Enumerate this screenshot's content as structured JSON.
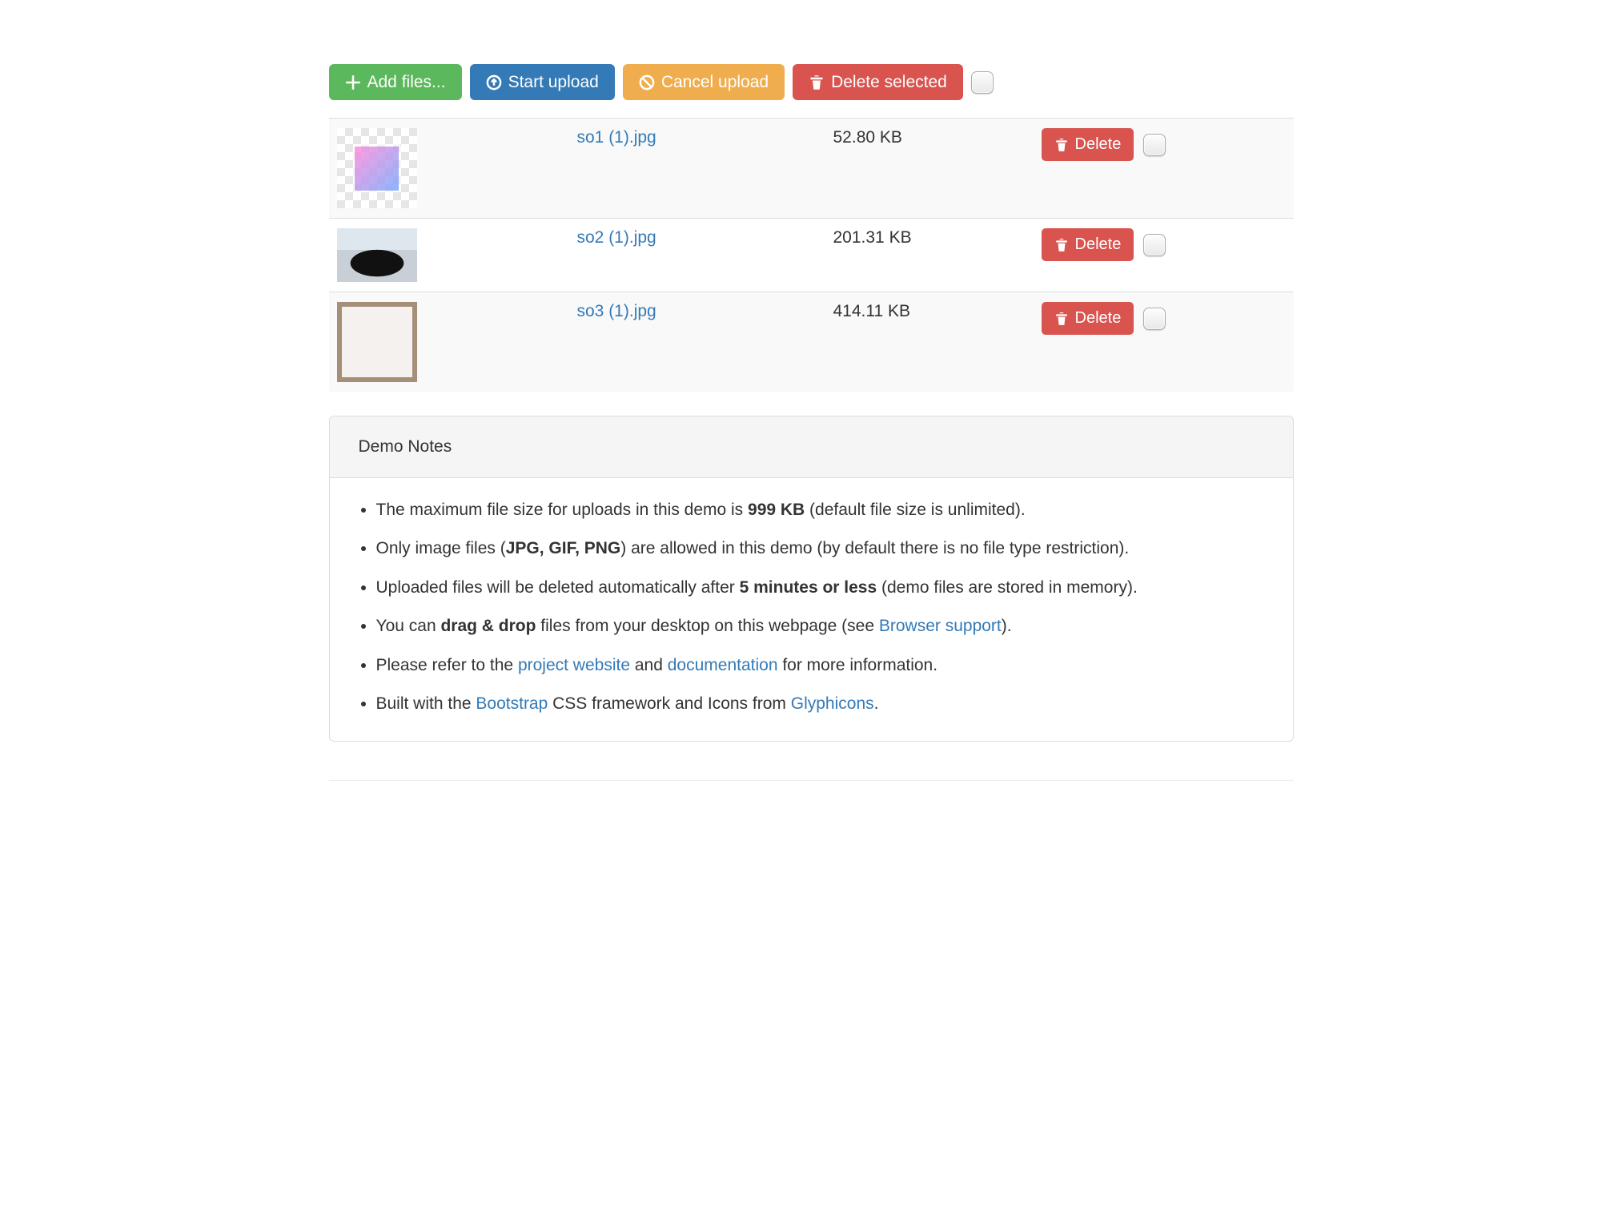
{
  "toolbar": {
    "add_label": "Add files...",
    "start_label": "Start upload",
    "cancel_label": "Cancel upload",
    "delete_selected_label": "Delete selected"
  },
  "files": [
    {
      "name": "so1 (1).jpg",
      "size": "52.80 KB",
      "delete_label": "Delete"
    },
    {
      "name": "so2 (1).jpg",
      "size": "201.31 KB",
      "delete_label": "Delete"
    },
    {
      "name": "so3 (1).jpg",
      "size": "414.11 KB",
      "delete_label": "Delete"
    }
  ],
  "panel": {
    "title": "Demo Notes",
    "notes": {
      "n1a": "The maximum file size for uploads in this demo is ",
      "n1b": "999 KB",
      "n1c": " (default file size is unlimited).",
      "n2a": "Only image files (",
      "n2b": "JPG, GIF, PNG",
      "n2c": ") are allowed in this demo (by default there is no file type restriction).",
      "n3a": "Uploaded files will be deleted automatically after ",
      "n3b": "5 minutes or less",
      "n3c": " (demo files are stored in memory).",
      "n4a": "You can ",
      "n4b": "drag & drop",
      "n4c": " files from your desktop on this webpage (see ",
      "n4link": "Browser support",
      "n4d": ").",
      "n5a": "Please refer to the ",
      "n5link1": "project website",
      "n5b": " and ",
      "n5link2": "documentation",
      "n5c": " for more information.",
      "n6a": "Built with the ",
      "n6link1": "Bootstrap",
      "n6b": " CSS framework and Icons from ",
      "n6link2": "Glyphicons",
      "n6c": "."
    }
  }
}
